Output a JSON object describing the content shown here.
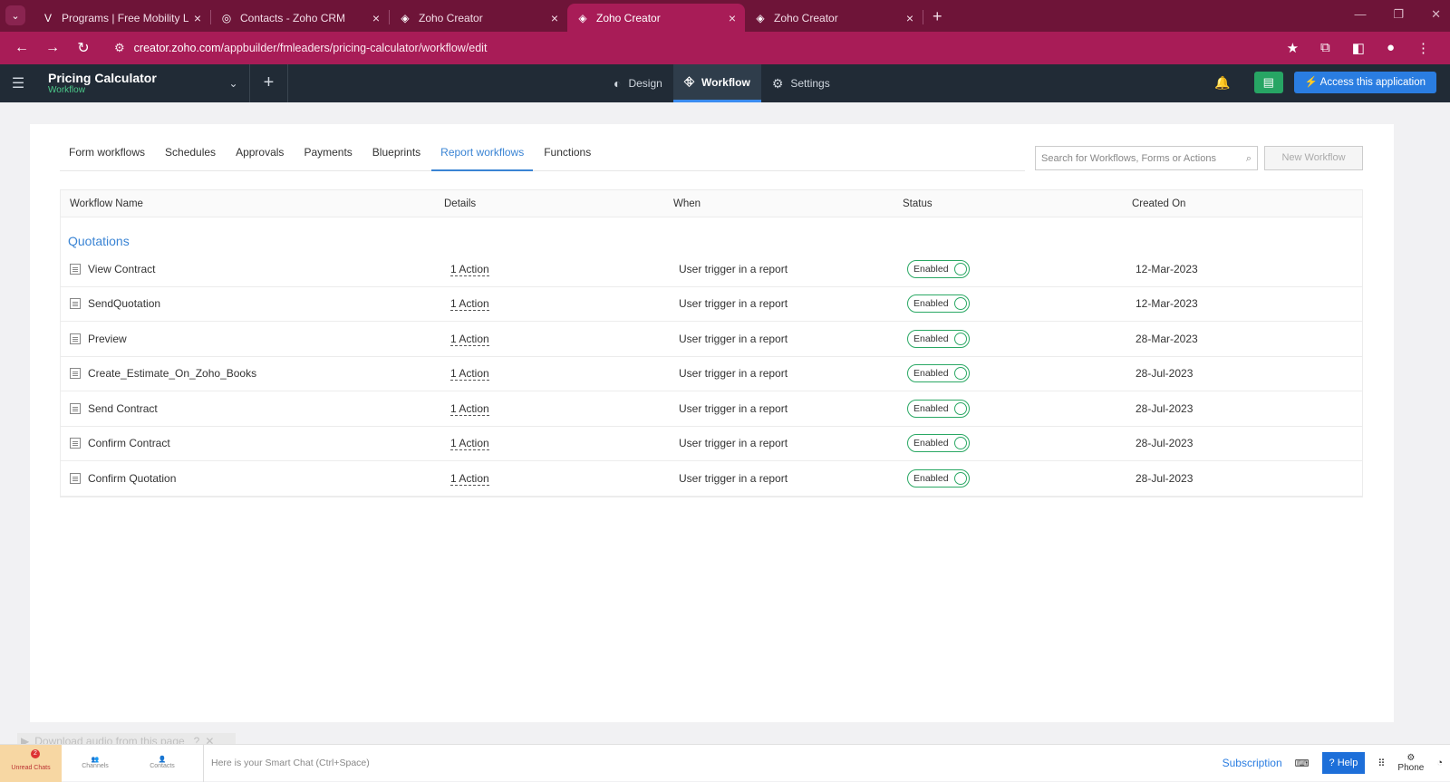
{
  "browser": {
    "tabs": [
      {
        "title": "Programs | Free Mobility Leade",
        "icon": "fml-logo-icon",
        "active": false
      },
      {
        "title": "Contacts - Zoho CRM",
        "icon": "zoho-crm-icon",
        "active": false
      },
      {
        "title": "Zoho Creator",
        "icon": "zoho-creator-icon",
        "active": false
      },
      {
        "title": "Zoho Creator",
        "icon": "zoho-creator-icon",
        "active": true
      },
      {
        "title": "Zoho Creator",
        "icon": "zoho-creator-icon",
        "active": false
      }
    ],
    "url_host": "creator.zoho.com",
    "url_path": "/appbuilder/fmleaders/pricing-calculator/workflow/edit"
  },
  "app": {
    "name": "Pricing Calculator",
    "section": "Workflow",
    "nav": {
      "design": "Design",
      "workflow": "Workflow",
      "settings": "Settings"
    },
    "access_label": "Access this application"
  },
  "content": {
    "tabs": [
      "Form workflows",
      "Schedules",
      "Approvals",
      "Payments",
      "Blueprints",
      "Report workflows",
      "Functions"
    ],
    "active_tab": "Report workflows",
    "search_placeholder": "Search for Workflows, Forms or Actions",
    "new_workflow_label": "New Workflow",
    "columns": {
      "name": "Workflow Name",
      "details": "Details",
      "when": "When",
      "status": "Status",
      "created": "Created On"
    },
    "group": "Quotations",
    "rows": [
      {
        "name": "View Contract",
        "details": "1 Action",
        "when": "User trigger in a report",
        "status": "Enabled",
        "created": "12-Mar-2023"
      },
      {
        "name": "SendQuotation",
        "details": "1 Action",
        "when": "User trigger in a report",
        "status": "Enabled",
        "created": "12-Mar-2023"
      },
      {
        "name": "Preview",
        "details": "1 Action",
        "when": "User trigger in a report",
        "status": "Enabled",
        "created": "28-Mar-2023"
      },
      {
        "name": "Create_Estimate_On_Zoho_Books",
        "details": "1 Action",
        "when": "User trigger in a report",
        "status": "Enabled",
        "created": "28-Jul-2023"
      },
      {
        "name": "Send Contract",
        "details": "1 Action",
        "when": "User trigger in a report",
        "status": "Enabled",
        "created": "28-Jul-2023"
      },
      {
        "name": "Confirm Contract",
        "details": "1 Action",
        "when": "User trigger in a report",
        "status": "Enabled",
        "created": "28-Jul-2023"
      },
      {
        "name": "Confirm Quotation",
        "details": "1 Action",
        "when": "User trigger in a report",
        "status": "Enabled",
        "created": "28-Jul-2023"
      }
    ]
  },
  "footer": {
    "download_audio": "Download audio from this page",
    "unread_chats": "Unread Chats",
    "unread_count": "2",
    "channels": "Channels",
    "contacts": "Contacts",
    "smart_chat": "Here is your Smart Chat (Ctrl+Space)",
    "subscription": "Subscription",
    "help": "Help",
    "phone": "Phone"
  },
  "colors": {
    "tabbar": "#6e1438",
    "addrbar": "#a81c57",
    "appheader": "#212b36",
    "accent": "#3a84d4",
    "enabled": "#2aa864"
  }
}
